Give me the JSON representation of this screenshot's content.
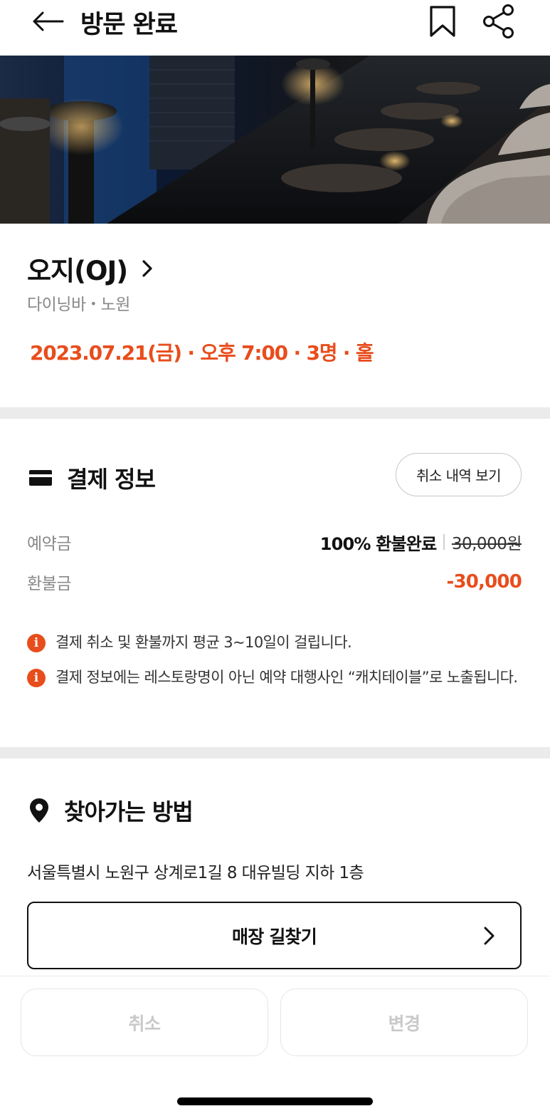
{
  "header": {
    "title": "방문 완료",
    "back_icon": "arrow-left-icon",
    "bookmark_icon": "bookmark-icon",
    "share_icon": "share-icon"
  },
  "hero": {
    "subject": "bar-interior-photo"
  },
  "restaurant": {
    "name": "오지(OJ)",
    "category": "다이닝바",
    "location": "노원",
    "reservation": "2023.07.21(금) · 오후 7:00 · 3명 · 홀"
  },
  "payment": {
    "title": "결제 정보",
    "cancel_history_label": "취소 내역 보기",
    "deposit_label": "예약금",
    "refund_status": "100% 환불완료",
    "deposit_amount": "30,000원",
    "refund_label": "환불금",
    "refund_amount": "-30,000",
    "notices": [
      "결제 취소 및 환불까지 평균 3~10일이 걸립니다.",
      "결제 정보에는 레스토랑명이 아닌 예약 대행사인 “캐치테이블”로 노출됩니다."
    ]
  },
  "directions": {
    "title": "찾아가는 방법",
    "address": "서울특별시 노원구 상계로1길 8 대유빌딩 지하 1층",
    "map_button_label": "매장 길찾기"
  },
  "bottom": {
    "cancel_label": "취소",
    "change_label": "변경"
  },
  "colors": {
    "accent": "#e84d1c",
    "disabled_text": "#c9c9c9",
    "divider": "#ebebeb"
  }
}
